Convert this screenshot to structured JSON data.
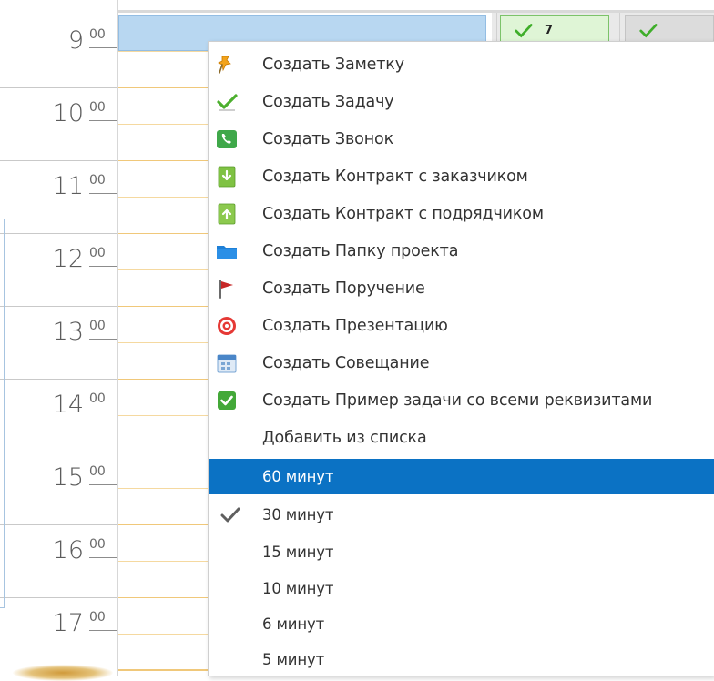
{
  "time_grid": {
    "hours": [
      {
        "hour": "9",
        "minutes": "00"
      },
      {
        "hour": "10",
        "minutes": "00"
      },
      {
        "hour": "11",
        "minutes": "00"
      },
      {
        "hour": "12",
        "minutes": "00"
      },
      {
        "hour": "13",
        "minutes": "00"
      },
      {
        "hour": "14",
        "minutes": "00"
      },
      {
        "hour": "15",
        "minutes": "00"
      },
      {
        "hour": "16",
        "minutes": "00"
      },
      {
        "hour": "17",
        "minutes": "00"
      }
    ]
  },
  "side_panel": {
    "task_badge_count": "7"
  },
  "context_menu": {
    "create_items": [
      {
        "label": "Создать Заметку",
        "icon": "pushpin-icon"
      },
      {
        "label": "Создать Задачу",
        "icon": "green-check-icon"
      },
      {
        "label": "Создать Звонок",
        "icon": "phone-icon"
      },
      {
        "label": "Создать Контракт с заказчиком",
        "icon": "contract-down-icon"
      },
      {
        "label": "Создать Контракт с подрядчиком",
        "icon": "contract-up-icon"
      },
      {
        "label": "Создать Папку проекта",
        "icon": "folder-icon"
      },
      {
        "label": "Создать Поручение",
        "icon": "flag-icon"
      },
      {
        "label": "Создать Презентацию",
        "icon": "target-icon"
      },
      {
        "label": "Создать Совещание",
        "icon": "meeting-calendar-icon"
      },
      {
        "label": "Создать Пример задачи со всеми реквизитами",
        "icon": "checkbox-icon"
      }
    ],
    "add_from_list": "Добавить из списка",
    "interval_options": [
      {
        "label": "60 минут",
        "state": "highlighted"
      },
      {
        "label": "30 минут",
        "state": "checked"
      },
      {
        "label": "15 минут",
        "state": "normal"
      },
      {
        "label": "10 минут",
        "state": "normal"
      },
      {
        "label": "6 минут",
        "state": "normal"
      },
      {
        "label": "5 минут",
        "state": "normal"
      }
    ]
  },
  "colors": {
    "highlight": "#0b72c4",
    "selected_slot": "#b8d7f1",
    "hour_line": "#f0c87a",
    "task_green": "#4caf2e"
  }
}
